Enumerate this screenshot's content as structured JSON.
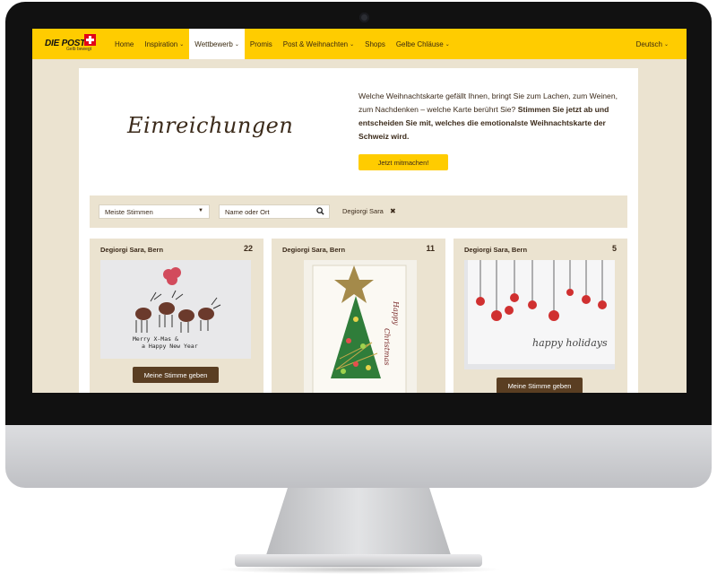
{
  "nav": {
    "logo_text": "DIE POST",
    "logo_tagline": "Gelb bewegt",
    "items": [
      {
        "label": "Home",
        "caret": ""
      },
      {
        "label": "Inspiration",
        "caret": "⌄"
      },
      {
        "label": "Wettbewerb",
        "caret": "⌄"
      },
      {
        "label": "Promis",
        "caret": ""
      },
      {
        "label": "Post & Weihnachten",
        "caret": "⌄"
      },
      {
        "label": "Shops",
        "caret": ""
      },
      {
        "label": "Gelbe Chläuse",
        "caret": "⌄"
      }
    ],
    "active_item": "Wettbewerb",
    "language": "Deutsch"
  },
  "hero": {
    "title": "Einreichungen",
    "intro": "Welche Weihnachtskarte gefällt Ihnen, bringt Sie zum Lachen, zum Weinen, zum Nachdenken – welche Karte berührt Sie?",
    "intro_bold": "Stimmen Sie jetzt ab und entscheiden Sie mit, welches die emotionalste Weihnachtskarte der Schweiz  wird.",
    "cta_label": "Jetzt mitmachen!"
  },
  "filters": {
    "sort_value": "Meiste Stimmen",
    "search_placeholder": "Name oder Ort",
    "active_tag": "Degiorgi Sara"
  },
  "cards": [
    {
      "author": "Degiorgi Sara, Bern",
      "votes": "22",
      "vote_label": "Meine Stimme geben",
      "image_text": [
        "Merry X-Mas &",
        "a Happy New Year"
      ]
    },
    {
      "author": "Degiorgi Sara, Bern",
      "votes": "11",
      "image_text": [
        "Happy",
        "Christmas"
      ]
    },
    {
      "author": "Degiorgi Sara, Bern",
      "votes": "5",
      "vote_label": "Meine Stimme geben",
      "image_text": [
        "happy holidays"
      ]
    }
  ],
  "colors": {
    "brand_yellow": "#ffcc00",
    "beige": "#ebe3d0",
    "button_brown": "#5a3e22",
    "text_brown": "#3b2a1a"
  },
  "icons": {
    "search": "magnifier-icon",
    "remove_tag": "close-icon",
    "dropdown": "chevron-down-icon"
  }
}
